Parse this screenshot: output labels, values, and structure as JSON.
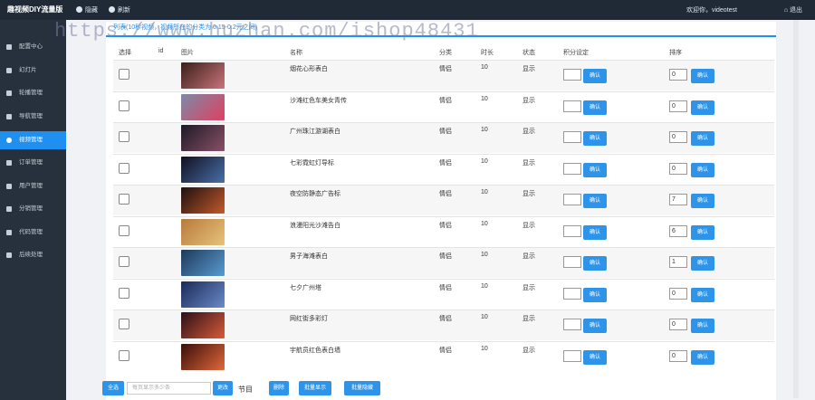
{
  "topbar": {
    "brand": "趣视频DIY流量版",
    "hide_label": "隐藏",
    "refresh_label": "刷新",
    "welcome": "欢迎你，videotest",
    "logout_label": "退出"
  },
  "sidebar": {
    "items": [
      {
        "label": "配置中心"
      },
      {
        "label": "幻灯片"
      },
      {
        "label": "轮播管理"
      },
      {
        "label": "导航管理"
      },
      {
        "label": "视频管理"
      },
      {
        "label": "订单管理"
      },
      {
        "label": "用户管理"
      },
      {
        "label": "分销管理"
      },
      {
        "label": "代码管理"
      },
      {
        "label": "后续处理"
      }
    ],
    "active": "视频管理"
  },
  "notice": "列表(10秒视频，视频所在的分类为 0.15-0.2元之间)",
  "watermark": "https://www.huzhan.com/ishop48431",
  "table": {
    "headers": {
      "select": "选择",
      "id": "id",
      "image": "图片",
      "name": "名称",
      "category": "分类",
      "duration": "时长",
      "status": "状态",
      "points": "积分设定",
      "sort": "排序"
    },
    "confirm_label": "确认",
    "rows": [
      {
        "name": "烟花心形表白",
        "category": "情侣",
        "duration": "10",
        "status": "显示",
        "sort": "0",
        "thumb": [
          "#3a1f1a",
          "#c9747a"
        ]
      },
      {
        "name": "沙滩红色车美女青传",
        "category": "情侣",
        "duration": "10",
        "status": "显示",
        "sort": "0",
        "thumb": [
          "#7c8aa8",
          "#e04060"
        ]
      },
      {
        "name": "广州珠江游湖表白",
        "category": "情侣",
        "duration": "10",
        "status": "显示",
        "sort": "0",
        "thumb": [
          "#1c1a26",
          "#8a5066"
        ]
      },
      {
        "name": "七彩霓虹灯导标",
        "category": "情侣",
        "duration": "10",
        "status": "显示",
        "sort": "0",
        "thumb": [
          "#101020",
          "#4a6fa8"
        ]
      },
      {
        "name": "夜空防静态广告标",
        "category": "情侣",
        "duration": "10",
        "status": "显示",
        "sort": "7",
        "thumb": [
          "#1e1010",
          "#c25a2a"
        ]
      },
      {
        "name": "浪漫阳光沙滩告白",
        "category": "情侣",
        "duration": "10",
        "status": "显示",
        "sort": "6",
        "thumb": [
          "#b77a3a",
          "#e7c27a"
        ]
      },
      {
        "name": "男子海滩表白",
        "category": "情侣",
        "duration": "10",
        "status": "显示",
        "sort": "1",
        "thumb": [
          "#1d3a5a",
          "#5a9ad0"
        ]
      },
      {
        "name": "七夕广州塔",
        "category": "情侣",
        "duration": "10",
        "status": "显示",
        "sort": "0",
        "thumb": [
          "#1a2a58",
          "#6a8ac8"
        ]
      },
      {
        "name": "网红街多彩灯",
        "category": "情侣",
        "duration": "10",
        "status": "显示",
        "sort": "0",
        "thumb": [
          "#2a1018",
          "#d85a3a"
        ]
      },
      {
        "name": "宇航员红色表白墙",
        "category": "情侣",
        "duration": "10",
        "status": "显示",
        "sort": "0",
        "thumb": [
          "#3a0e0a",
          "#e0683a"
        ]
      }
    ]
  },
  "bottom": {
    "select_all": "全选",
    "per_page_placeholder": "每页显示多少条",
    "change_label": "更改",
    "count_text": "节目",
    "delete_label": "删除",
    "batch_show": "批量显示",
    "batch_hide": "批量隐藏"
  },
  "colors": {
    "accent": "#2e94ea",
    "sidebar_bg": "#27313d",
    "topbar_bg": "#1f2a36",
    "active_item": "#1f8ff0"
  }
}
